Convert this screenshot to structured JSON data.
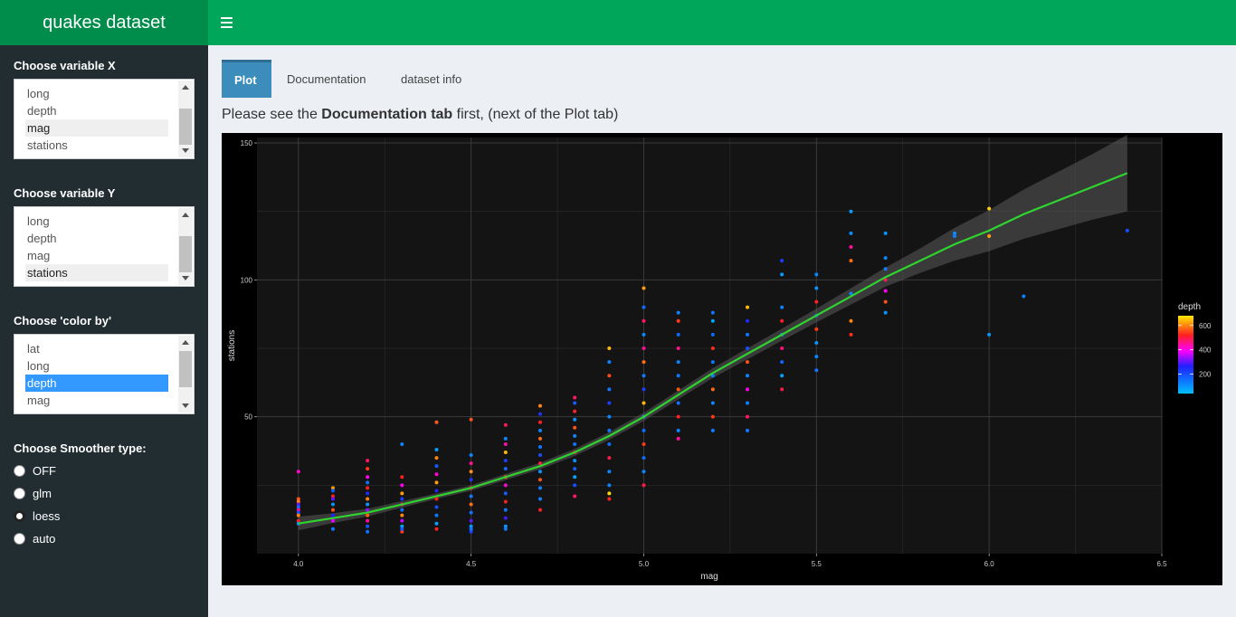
{
  "header": {
    "title": "quakes dataset",
    "menu_icon": "hamburger-icon"
  },
  "sidebar": {
    "x": {
      "label": "Choose variable X",
      "options": [
        "long",
        "depth",
        "mag",
        "stations"
      ],
      "selected": "mag"
    },
    "y": {
      "label": "Choose variable Y",
      "options": [
        "long",
        "depth",
        "mag",
        "stations"
      ],
      "selected": "stations"
    },
    "color": {
      "label": "Choose 'color by'",
      "options": [
        "lat",
        "long",
        "depth",
        "mag"
      ],
      "selected": "depth"
    },
    "smoother": {
      "label": "Choose Smoother type:",
      "options": [
        "OFF",
        "glm",
        "loess",
        "auto"
      ],
      "selected": "loess"
    }
  },
  "tabs": [
    {
      "label": "Plot",
      "active": true
    },
    {
      "label": "Documentation",
      "active": false
    },
    {
      "label": "dataset info",
      "active": false
    }
  ],
  "note": {
    "pre": "Please see the ",
    "bold": "Documentation tab",
    "post": " first, (next of the Plot tab)"
  },
  "chart_data": {
    "type": "scatter",
    "xlabel": "mag",
    "ylabel": "stations",
    "xlim": [
      3.88,
      6.5
    ],
    "ylim": [
      0,
      152
    ],
    "x_ticks": [
      "4.0",
      "4.5",
      "5.0",
      "5.5",
      "6.0",
      "6.5"
    ],
    "y_ticks": [
      "50",
      "100",
      "150"
    ],
    "legend": {
      "title": "depth",
      "ticks": [
        "200",
        "400",
        "600"
      ],
      "range": [
        40,
        680
      ],
      "placement": "right"
    },
    "colors": {
      "panel": "#141414",
      "background": "#000000",
      "smoother": "#2fd42f",
      "ribbon": "#5a5a5a"
    },
    "smoother": {
      "method": "loess",
      "x": [
        4.0,
        4.1,
        4.2,
        4.3,
        4.4,
        4.5,
        4.6,
        4.7,
        4.8,
        4.9,
        5.0,
        5.1,
        5.2,
        5.3,
        5.4,
        5.5,
        5.6,
        5.7,
        5.8,
        5.9,
        6.0,
        6.1,
        6.2,
        6.3,
        6.4
      ],
      "y": [
        11,
        13,
        15,
        18,
        21,
        24,
        28,
        32,
        37,
        43,
        50,
        58,
        66,
        73,
        80,
        87,
        94,
        101,
        107,
        113,
        118,
        124,
        129,
        134,
        139
      ],
      "se": [
        2.5,
        1.8,
        1.4,
        1.2,
        1.0,
        1.0,
        1.1,
        1.2,
        1.3,
        1.4,
        1.5,
        1.6,
        1.8,
        2.0,
        2.2,
        2.5,
        3.0,
        3.5,
        4.5,
        6.0,
        7.5,
        9.0,
        10.5,
        12.0,
        14.0
      ]
    },
    "series": [
      {
        "name": "depth",
        "x": [
          4.0,
          4.0,
          4.0,
          4.0,
          4.0,
          4.0,
          4.0,
          4.0,
          4.0,
          4.0,
          4.1,
          4.1,
          4.1,
          4.1,
          4.1,
          4.1,
          4.1,
          4.1,
          4.1,
          4.2,
          4.2,
          4.2,
          4.2,
          4.2,
          4.2,
          4.2,
          4.2,
          4.2,
          4.2,
          4.2,
          4.2,
          4.2,
          4.3,
          4.3,
          4.3,
          4.3,
          4.3,
          4.3,
          4.3,
          4.3,
          4.3,
          4.3,
          4.3,
          4.3,
          4.4,
          4.4,
          4.4,
          4.4,
          4.4,
          4.4,
          4.4,
          4.4,
          4.4,
          4.4,
          4.4,
          4.4,
          4.4,
          4.5,
          4.5,
          4.5,
          4.5,
          4.5,
          4.5,
          4.5,
          4.5,
          4.5,
          4.5,
          4.5,
          4.5,
          4.5,
          4.6,
          4.6,
          4.6,
          4.6,
          4.6,
          4.6,
          4.6,
          4.6,
          4.6,
          4.6,
          4.6,
          4.6,
          4.6,
          4.6,
          4.7,
          4.7,
          4.7,
          4.7,
          4.7,
          4.7,
          4.7,
          4.7,
          4.7,
          4.7,
          4.7,
          4.7,
          4.7,
          4.8,
          4.8,
          4.8,
          4.8,
          4.8,
          4.8,
          4.8,
          4.8,
          4.8,
          4.8,
          4.8,
          4.8,
          4.8,
          4.9,
          4.9,
          4.9,
          4.9,
          4.9,
          4.9,
          4.9,
          4.9,
          4.9,
          4.9,
          4.9,
          4.9,
          4.9,
          5.0,
          5.0,
          5.0,
          5.0,
          5.0,
          5.0,
          5.0,
          5.0,
          5.0,
          5.0,
          5.0,
          5.0,
          5.0,
          5.0,
          5.0,
          5.1,
          5.1,
          5.1,
          5.1,
          5.1,
          5.1,
          5.1,
          5.1,
          5.1,
          5.1,
          5.1,
          5.2,
          5.2,
          5.2,
          5.2,
          5.2,
          5.2,
          5.2,
          5.2,
          5.2,
          5.2,
          5.3,
          5.3,
          5.3,
          5.3,
          5.3,
          5.3,
          5.3,
          5.3,
          5.3,
          5.3,
          5.4,
          5.4,
          5.4,
          5.4,
          5.4,
          5.4,
          5.4,
          5.4,
          5.4,
          5.5,
          5.5,
          5.5,
          5.5,
          5.5,
          5.5,
          5.5,
          5.5,
          5.6,
          5.6,
          5.6,
          5.6,
          5.6,
          5.6,
          5.6,
          5.7,
          5.7,
          5.7,
          5.7,
          5.7,
          5.7,
          5.7,
          5.9,
          5.9,
          6.0,
          6.0,
          6.0,
          6.1,
          6.4
        ],
        "y": [
          30,
          20,
          19,
          18,
          17,
          16,
          15,
          14,
          12,
          11,
          24,
          23,
          21,
          20,
          18,
          16,
          14,
          12,
          9,
          34,
          31,
          28,
          26,
          24,
          22,
          20,
          18,
          16,
          14,
          12,
          10,
          8,
          28,
          25,
          22,
          20,
          18,
          16,
          14,
          12,
          10,
          8,
          9,
          40,
          48,
          38,
          35,
          32,
          29,
          26,
          23,
          20,
          17,
          14,
          11,
          9,
          48,
          36,
          33,
          30,
          27,
          24,
          21,
          18,
          15,
          12,
          10,
          8,
          9,
          49,
          47,
          42,
          40,
          37,
          34,
          31,
          28,
          25,
          22,
          19,
          16,
          13,
          10,
          9,
          54,
          51,
          48,
          45,
          42,
          39,
          36,
          33,
          30,
          27,
          24,
          20,
          16,
          57,
          55,
          52,
          49,
          46,
          43,
          40,
          37,
          34,
          31,
          28,
          25,
          21,
          75,
          70,
          65,
          60,
          55,
          50,
          45,
          40,
          35,
          30,
          25,
          22,
          20,
          97,
          90,
          85,
          80,
          75,
          70,
          65,
          60,
          55,
          50,
          45,
          40,
          35,
          30,
          25,
          88,
          85,
          80,
          75,
          70,
          65,
          60,
          55,
          50,
          45,
          42,
          88,
          85,
          80,
          75,
          70,
          65,
          60,
          55,
          50,
          45,
          90,
          85,
          80,
          75,
          70,
          65,
          60,
          55,
          50,
          45,
          107,
          102,
          90,
          85,
          80,
          75,
          70,
          65,
          60,
          102,
          97,
          92,
          87,
          82,
          77,
          72,
          67,
          125,
          117,
          112,
          107,
          95,
          85,
          80,
          117,
          108,
          104,
          100,
          96,
          92,
          88,
          117,
          116,
          126,
          116,
          80,
          94,
          118
        ],
        "depth": [
          420,
          560,
          600,
          300,
          150,
          450,
          200,
          600,
          520,
          100,
          620,
          180,
          520,
          300,
          100,
          560,
          260,
          380,
          140,
          480,
          540,
          400,
          150,
          520,
          250,
          600,
          100,
          330,
          570,
          450,
          190,
          150,
          520,
          400,
          620,
          220,
          490,
          150,
          600,
          360,
          80,
          540,
          180,
          120,
          140,
          90,
          600,
          180,
          420,
          620,
          260,
          520,
          200,
          140,
          90,
          520,
          560,
          120,
          460,
          610,
          230,
          520,
          140,
          580,
          150,
          300,
          100,
          220,
          140,
          560,
          490,
          120,
          440,
          640,
          220,
          160,
          560,
          420,
          180,
          520,
          140,
          280,
          100,
          130,
          600,
          240,
          520,
          120,
          580,
          140,
          200,
          500,
          100,
          560,
          130,
          140,
          520,
          480,
          180,
          520,
          100,
          560,
          120,
          150,
          520,
          110,
          180,
          80,
          200,
          480,
          640,
          130,
          550,
          140,
          220,
          120,
          140,
          160,
          500,
          120,
          120,
          670,
          520,
          620,
          160,
          480,
          120,
          450,
          580,
          140,
          220,
          640,
          100,
          160,
          540,
          160,
          120,
          500,
          130,
          540,
          160,
          460,
          120,
          140,
          560,
          150,
          520,
          120,
          450,
          140,
          80,
          160,
          530,
          140,
          130,
          580,
          120,
          540,
          130,
          640,
          250,
          140,
          200,
          560,
          120,
          400,
          130,
          480,
          140,
          220,
          90,
          130,
          520,
          120,
          470,
          170,
          80,
          500,
          120,
          100,
          520,
          140,
          540,
          100,
          120,
          140,
          90,
          110,
          450,
          580,
          120,
          600,
          530,
          100,
          120,
          130,
          490,
          400,
          560,
          100,
          110,
          130,
          660,
          620,
          100,
          130,
          200,
          120,
          160
        ]
      }
    ]
  }
}
